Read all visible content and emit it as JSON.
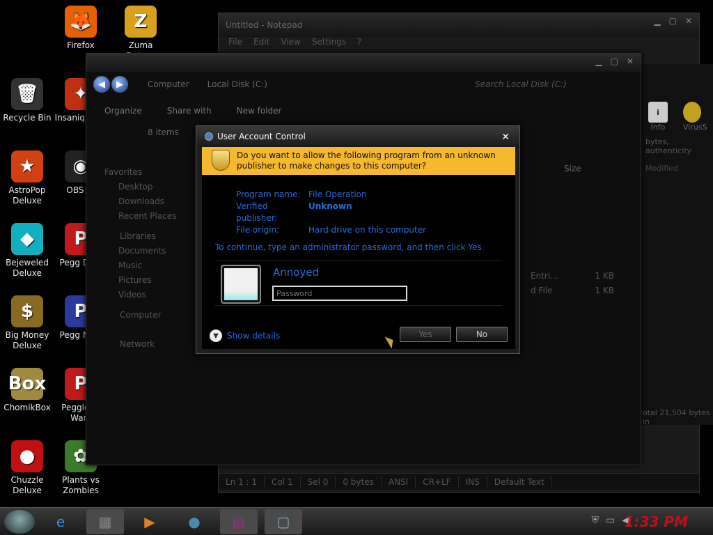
{
  "desktop_icons": [
    {
      "label": "Firefox",
      "glyph": "🦊",
      "color": "#e66000"
    },
    {
      "label": "Zuma Deluxe",
      "glyph": "Z",
      "color": "#d9a020"
    },
    {
      "label": "Recycle Bin",
      "glyph": "🗑",
      "color": "#333333"
    },
    {
      "label": "Insaniq Delu",
      "glyph": "✦",
      "color": "#c03010"
    },
    {
      "label": "AstroPop Deluxe",
      "glyph": "★",
      "color": "#d04010"
    },
    {
      "label": "OBS St",
      "glyph": "◉",
      "color": "#222222"
    },
    {
      "label": "Bejeweled Deluxe",
      "glyph": "◆",
      "color": "#10b0c0"
    },
    {
      "label": "Pegg Delu",
      "glyph": "P",
      "color": "#c01a1a"
    },
    {
      "label": "Big Money Deluxe",
      "glyph": "$",
      "color": "#8a6a20"
    },
    {
      "label": "Pegg Nigh",
      "glyph": "P",
      "color": "#2a3aa0"
    },
    {
      "label": "ChomikBox",
      "glyph": "Box",
      "color": "#a08a40"
    },
    {
      "label": "Peggle of Warc",
      "glyph": "P",
      "color": "#c01a1a"
    },
    {
      "label": "Chuzzle Deluxe",
      "glyph": "●",
      "color": "#c01010"
    },
    {
      "label": "Plants vs Zombies",
      "glyph": "✿",
      "color": "#3a7a2a"
    }
  ],
  "notepad": {
    "title": "Untitled - Notepad",
    "menu": [
      "File",
      "Edit",
      "View",
      "Settings",
      "?"
    ],
    "status": [
      "Ln 1 : 1",
      "Col 1",
      "Sel 0",
      "0 bytes",
      "ANSI",
      "CR+LF",
      "INS",
      "Default Text"
    ]
  },
  "side_window": {
    "icons": [
      "Info",
      "VirusS"
    ],
    "text1": "bytes, authenticity",
    "text2": "Modified",
    "text3": "otal 21,504 bytes in"
  },
  "explorer": {
    "breadcrumb": [
      "Computer",
      "Local Disk (C:)"
    ],
    "search_placeholder": "Search Local Disk (C:)",
    "toolbar": [
      "Organize",
      "Share with",
      "New folder"
    ],
    "item_count": "8 items",
    "size_header": "Size",
    "nav": {
      "favorites": "Favorites",
      "favorites_items": [
        "Desktop",
        "Downloads",
        "Recent Places"
      ],
      "libraries": "Libraries",
      "libraries_items": [
        "Documents",
        "Music",
        "Pictures",
        "Videos"
      ],
      "computer": "Computer",
      "network": "Network"
    },
    "files": [
      {
        "type": "Entri...",
        "size": "1 KB"
      },
      {
        "type": "d File",
        "size": "1 KB"
      }
    ]
  },
  "uac": {
    "title": "User Account Control",
    "question": "Do you want to allow the following program from an unknown publisher to make changes to this computer?",
    "details": [
      {
        "key": "Program name:",
        "value": "File Operation"
      },
      {
        "key": "Verified publisher:",
        "value": "Unknown"
      },
      {
        "key": "File origin:",
        "value": "Hard drive on this computer"
      }
    ],
    "continue_text": "To continue, type an administrator password, and then click Yes.",
    "username": "Annoyed",
    "password_placeholder": "Password",
    "show_details": "Show details",
    "yes_label": "Yes",
    "no_label": "No"
  },
  "taskbar": {
    "clock": "1:33 PM"
  }
}
